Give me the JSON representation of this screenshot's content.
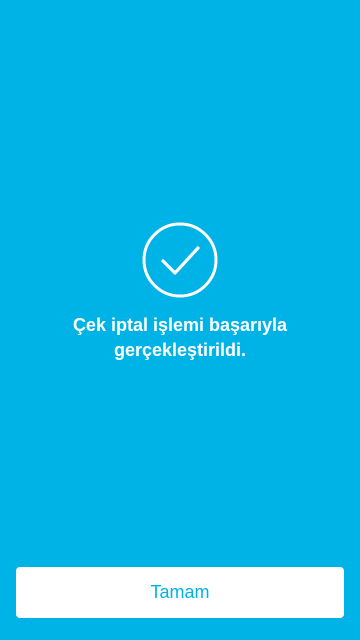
{
  "theme": {
    "background": "#00b3e6",
    "button_background": "#ffffff",
    "button_text": "#00b3e6",
    "foreground": "#ffffff"
  },
  "status": {
    "icon": "check-circle-icon",
    "message": "Çek iptal işlemi başarıyla\ngerçekleştirildi."
  },
  "actions": {
    "confirm_label": "Tamam"
  }
}
